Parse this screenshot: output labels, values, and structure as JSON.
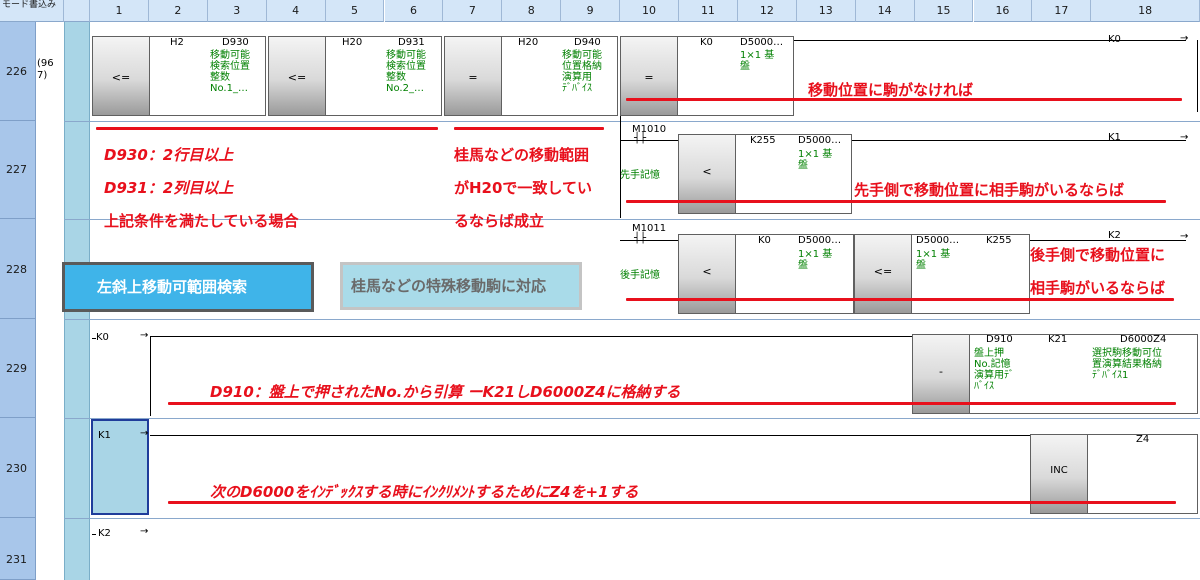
{
  "header": {
    "corner_label": "モード書込み",
    "dropdown_arrow": "▼",
    "columns": [
      "1",
      "2",
      "3",
      "4",
      "5",
      "6",
      "7",
      "8",
      "9",
      "10",
      "11",
      "12",
      "13",
      "14",
      "15",
      "16",
      "17",
      "18"
    ]
  },
  "rows": [
    {
      "num": "226",
      "step": "(96\n7)"
    },
    {
      "num": "227"
    },
    {
      "num": "228"
    },
    {
      "num": "229"
    },
    {
      "num": "230"
    },
    {
      "num": "231"
    }
  ],
  "ladder": {
    "r226": {
      "cmp1": {
        "op": "<=",
        "dev1": "H2",
        "dev2": "D930",
        "comment": "移動可能\n検索位置\n整数\nNo.1_…"
      },
      "cmp2": {
        "op": "<=",
        "dev1": "H20",
        "dev2": "D931",
        "comment": "移動可能\n検索位置\n整数\nNo.2_…"
      },
      "cmp3": {
        "op": "=",
        "dev1": "H20",
        "dev2": "D940",
        "comment": "移動可能\n位置格納\n演算用\nﾃﾞﾊﾞｲｽ"
      },
      "cmp4": {
        "op": "=",
        "dev1": "K0",
        "dev2": "D5000…",
        "comment": "1×1 基\n盤"
      },
      "coil": "K0"
    },
    "r227": {
      "contact": "M1010",
      "contact_comment": "先手記憶",
      "cmp": {
        "op": "<",
        "dev1": "K255",
        "dev2": "D5000…",
        "comment": "1×1 基\n盤"
      },
      "coil": "K1"
    },
    "r228": {
      "contact": "M1011",
      "contact_comment": "後手記憶",
      "cmp1": {
        "op": "<",
        "dev1": "K0",
        "dev2": "D5000…",
        "comment": "1×1 基\n盤"
      },
      "cmp2": {
        "op": "<=",
        "dev1": "D5000…",
        "dev2": "K255",
        "comment": "1×1 基\n盤"
      },
      "coil": "K2"
    },
    "r229": {
      "label": "K0",
      "inst": {
        "op": "-",
        "dev1": "D910",
        "dev2": "K21",
        "dev3": "D6000Z4",
        "comment1": "盤上押\nNo.記憶\n演算用ﾃﾞ\nﾊﾞｲｽ",
        "comment3": "選択駒移動可位\n置演算結果格納\nﾃﾞﾊﾞｲｽ1"
      }
    },
    "r230": {
      "label": "K1",
      "inst": {
        "op": "INC",
        "dev1": "Z4"
      }
    },
    "r231": {
      "label": "K2"
    }
  },
  "annotations": {
    "a1": "移動位置に駒がなければ",
    "a2_1": "D930：2行目以上",
    "a2_2": "D931：2列目以上",
    "a2_3": "上記条件を満たしている場合",
    "a3_1": "桂馬などの移動範囲",
    "a3_2": "がH20で一致してい",
    "a3_3": "るならば成立",
    "a4": "先手側で移動位置に相手駒がいるならば",
    "a5_1": "後手側で移動位置に",
    "a5_2": "相手駒がいるならば",
    "a6": "D910：盤上で押されたNo.から引算 ーK21しD6000Z4に格納する",
    "a7": "次のD6000をｲﾝﾃﾞｯｸｽする時にｲﾝｸﾘﾒﾝﾄするためにZ4を+1する",
    "btn1": "左斜上移動可範囲検索",
    "btn2": "桂馬などの特殊移動駒に対応"
  },
  "colors": {
    "accent_red": "#e8101c",
    "comment_green": "#008000",
    "header_blue": "#d4e6f8",
    "rownum_blue": "#a8c6ea",
    "button1_blue": "#3fb4e9",
    "button2_lightblue": "#a9dbe9"
  }
}
